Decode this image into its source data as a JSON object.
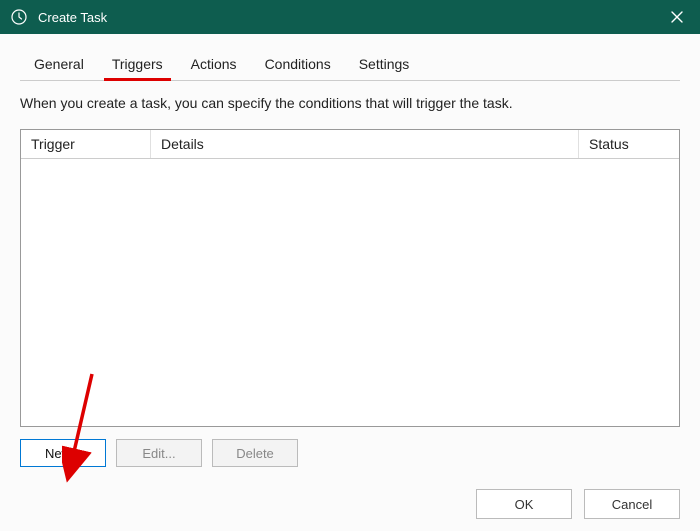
{
  "titlebar": {
    "title": "Create Task"
  },
  "tabs": {
    "items": [
      {
        "label": "General"
      },
      {
        "label": "Triggers"
      },
      {
        "label": "Actions"
      },
      {
        "label": "Conditions"
      },
      {
        "label": "Settings"
      }
    ],
    "active_index": 1
  },
  "description": "When you create a task, you can specify the conditions that will trigger the task.",
  "list": {
    "headers": {
      "trigger": "Trigger",
      "details": "Details",
      "status": "Status"
    },
    "rows": []
  },
  "buttons": {
    "new": "New...",
    "edit": "Edit...",
    "delete": "Delete"
  },
  "footer": {
    "ok": "OK",
    "cancel": "Cancel"
  }
}
